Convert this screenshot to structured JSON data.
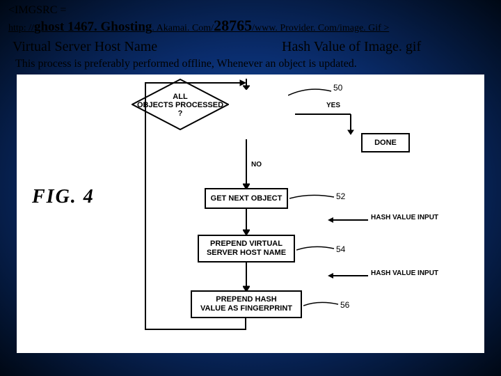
{
  "header": {
    "imgsrc_tag": "<IMGSRC =",
    "url_prefix": "http: //",
    "url_host_bold": "ghost 1467. Ghosting",
    "url_mid": ". Akamai. Com/",
    "url_hash_bold": "28765",
    "url_suffix": "/www. Provider. Com/image. Gif >"
  },
  "labels": {
    "left": "Virtual Server Host Name",
    "right": "Hash Value of Image. gif"
  },
  "subnote": "This process is preferably performed offline, Whenever an object is updated.",
  "figure": {
    "label": "FIG. 4",
    "numbers": {
      "dec": "50",
      "r1": "52",
      "r2": "54",
      "r3": "56"
    },
    "decision": {
      "line1": "ALL",
      "line2": "OBJECTS PROCESSED",
      "line3": "?"
    },
    "yes": "YES",
    "no": "NO",
    "done": "DONE",
    "rect1": "GET NEXT OBJECT",
    "rect2a": "PREPEND VIRTUAL",
    "rect2b": "SERVER HOST NAME",
    "rect3a": "PREPEND HASH",
    "rect3b": "VALUE AS FINGERPRINT",
    "hash_input": "HASH VALUE INPUT"
  }
}
